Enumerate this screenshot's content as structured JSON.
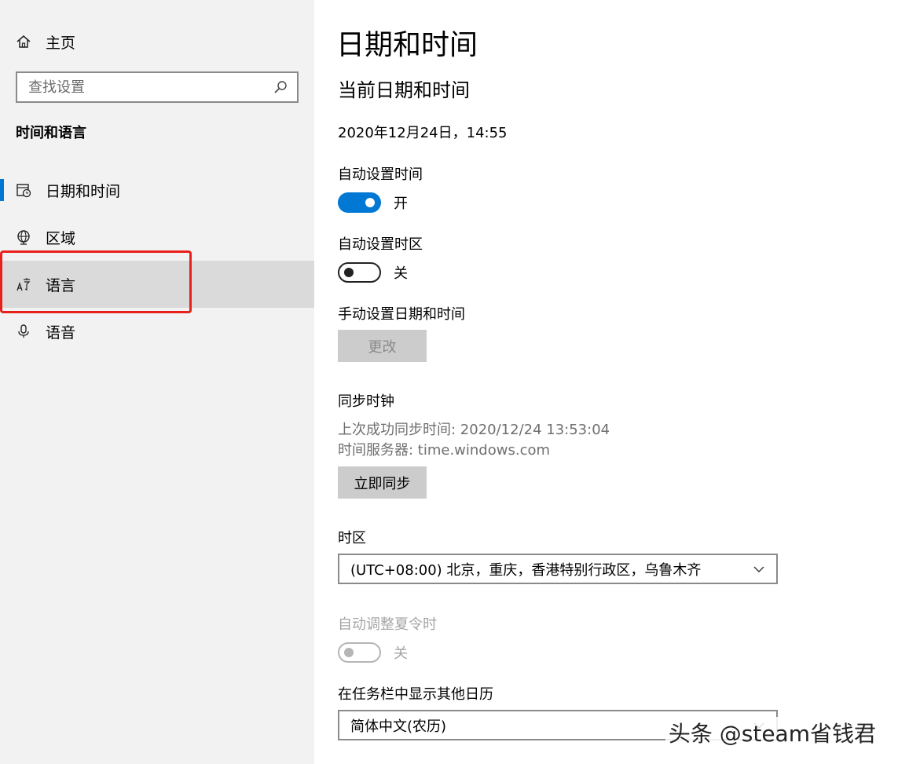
{
  "sidebar": {
    "home_label": "主页",
    "search_placeholder": "查找设置",
    "section_title": "时间和语言",
    "items": [
      {
        "label": "日期和时间",
        "icon": "calendar-clock-icon"
      },
      {
        "label": "区域",
        "icon": "globe-icon"
      },
      {
        "label": "语言",
        "icon": "language-icon"
      },
      {
        "label": "语音",
        "icon": "microphone-icon"
      }
    ]
  },
  "main": {
    "page_title": "日期和时间",
    "current_heading": "当前日期和时间",
    "current_datetime": "2020年12月24日，14:55",
    "auto_time_label": "自动设置时间",
    "auto_time_state": "开",
    "auto_timezone_label": "自动设置时区",
    "auto_timezone_state": "关",
    "manual_label": "手动设置日期和时间",
    "change_button": "更改",
    "sync_heading": "同步时钟",
    "last_sync": "上次成功同步时间: 2020/12/24 13:53:04",
    "time_server": "时间服务器: time.windows.com",
    "sync_button": "立即同步",
    "timezone_label": "时区",
    "timezone_value": "(UTC+08:00) 北京，重庆，香港特别行政区，乌鲁木齐",
    "dst_label": "自动调整夏令时",
    "dst_state": "关",
    "calendar_label": "在任务栏中显示其他日历",
    "calendar_value": "简体中文(农历)"
  },
  "watermark": "头条 @steam省钱君",
  "colors": {
    "accent": "#0078d4",
    "highlight": "#e8201b",
    "sidebar_bg": "#f2f2f2"
  }
}
